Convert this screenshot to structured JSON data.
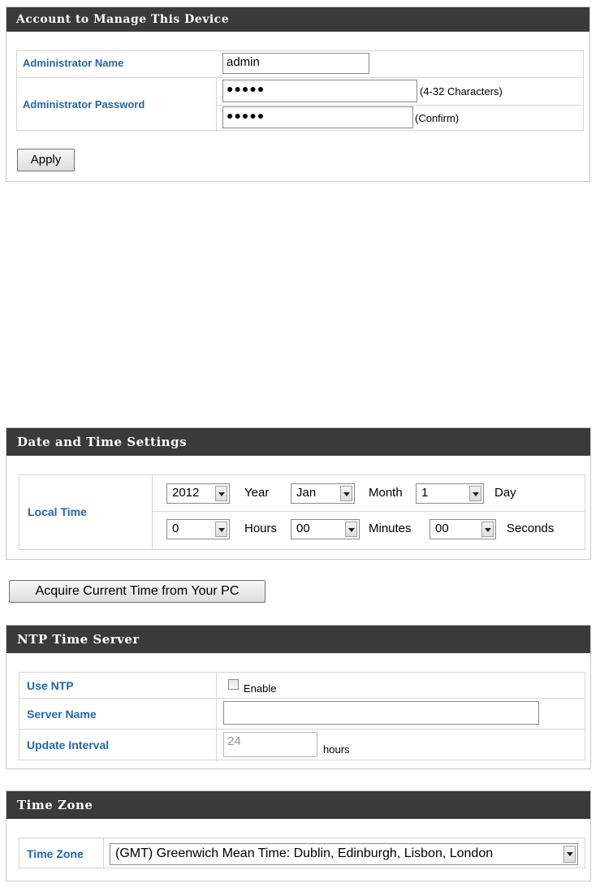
{
  "account": {
    "title": "Account to Manage This Device",
    "admin_name_label": "Administrator Name",
    "admin_name_value": "admin",
    "admin_password_label": "Administrator Password",
    "password_value": "●●●●●",
    "password_hint": "(4-32 Characters)",
    "confirm_value": "●●●●●",
    "confirm_hint": "(Confirm)",
    "apply_label": "Apply"
  },
  "datetime": {
    "title": "Date and Time Settings",
    "local_time_label": "Local Time",
    "year_value": "2012",
    "year_unit": "Year",
    "month_value": "Jan",
    "month_unit": "Month",
    "day_value": "1",
    "day_unit": "Day",
    "hours_value": "0",
    "hours_unit": "Hours",
    "minutes_value": "00",
    "minutes_unit": "Minutes",
    "seconds_value": "00",
    "seconds_unit": "Seconds",
    "acquire_label": "Acquire Current Time from Your PC"
  },
  "ntp": {
    "title": "NTP Time Server",
    "use_ntp_label": "Use NTP",
    "enable_label": "Enable",
    "enable_checked": false,
    "server_name_label": "Server Name",
    "server_name_value": "",
    "update_interval_label": "Update Interval",
    "update_interval_value": "24",
    "update_interval_unit": "hours"
  },
  "timezone": {
    "title": "Time Zone",
    "label": "Time Zone",
    "value": "(GMT) Greenwich Mean Time: Dublin, Edinburgh, Lisbon, London"
  },
  "colors": {
    "header_bg": "#3a3a3a",
    "label_blue": "#2166b0",
    "border": "#d6d6d6"
  }
}
